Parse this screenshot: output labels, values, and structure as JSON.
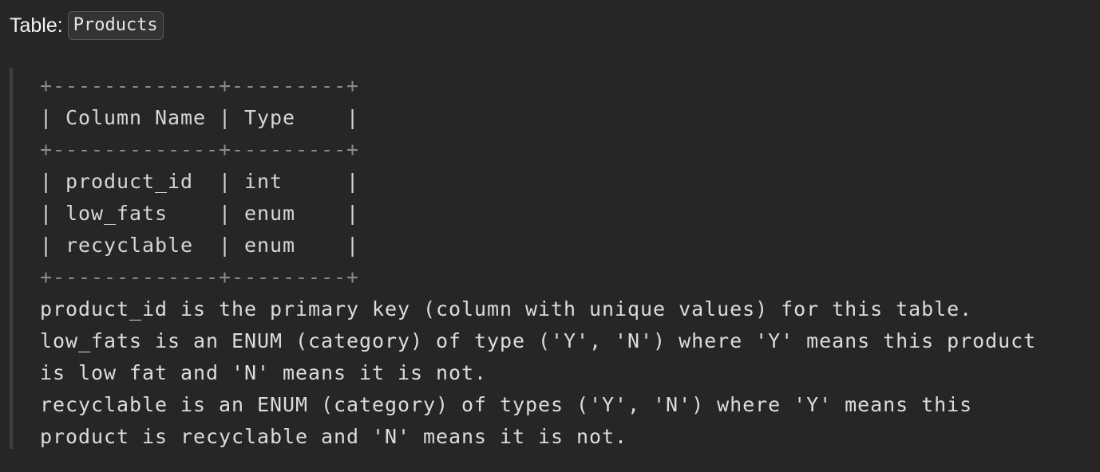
{
  "heading": {
    "label": "Table:",
    "table_name": "Products"
  },
  "schema_table": {
    "border": "+-------------+---------+",
    "header": "| Column Name | Type    |",
    "rows": [
      "| product_id  | int     |",
      "| low_fats    | enum    |",
      "| recyclable  | enum    |"
    ]
  },
  "description": [
    "product_id is the primary key (column with unique values) for this table.",
    "low_fats is an ENUM (category) of type ('Y', 'N') where 'Y' means this product",
    "is low fat and 'N' means it is not.",
    "recyclable is an ENUM (category) of types ('Y', 'N') where 'Y' means this",
    "product is recyclable and 'N' means it is not."
  ],
  "colors": {
    "background": "#262626",
    "text": "#e6e6e6",
    "quote_bar": "#3e3e3e",
    "chip_border": "#5a5a5a"
  }
}
